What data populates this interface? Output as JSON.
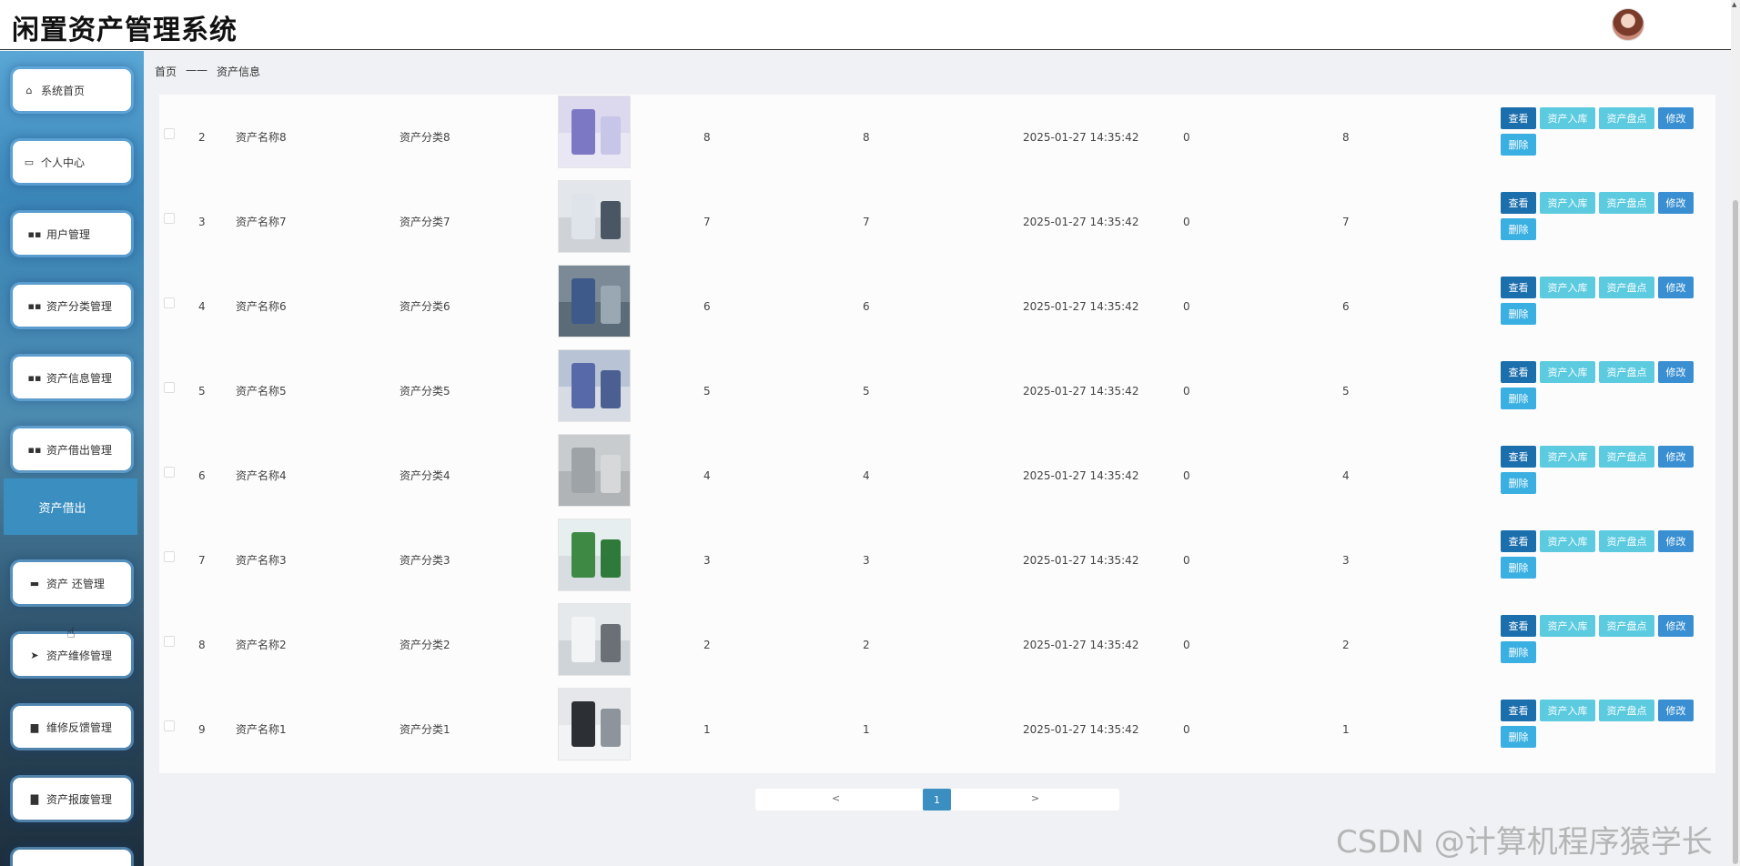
{
  "app": {
    "title": "闲置资产管理系统"
  },
  "sidebar": {
    "items": [
      {
        "label": "系统首页",
        "icon": "home-icon"
      },
      {
        "label": "个人中心",
        "icon": "card-icon"
      },
      {
        "label": "用户管理",
        "icon": "grid-icon"
      },
      {
        "label": "资产分类管理",
        "icon": "grid-icon"
      },
      {
        "label": "资产信息管理",
        "icon": "grid-icon"
      },
      {
        "label": "资产借出管理",
        "icon": "grid-icon"
      },
      {
        "label": "资产 还管理",
        "icon": "chat-icon"
      },
      {
        "label": "资产维修管理",
        "icon": "send-icon"
      },
      {
        "label": "维修反馈管理",
        "icon": "printer-icon"
      },
      {
        "label": "资产报废管理",
        "icon": "monitor-icon"
      }
    ],
    "submenu_active": "资产借出"
  },
  "breadcrumb": {
    "home": "首页",
    "separator": "——",
    "current": "资产信息"
  },
  "table": {
    "rows": [
      {
        "index": "2",
        "name": "资产名称8",
        "category": "资产分类8",
        "col_a": "8",
        "col_b": "8",
        "time": "2025-01-27 14:35:42",
        "col_c": "0",
        "col_d": "8"
      },
      {
        "index": "3",
        "name": "资产名称7",
        "category": "资产分类7",
        "col_a": "7",
        "col_b": "7",
        "time": "2025-01-27 14:35:42",
        "col_c": "0",
        "col_d": "7"
      },
      {
        "index": "4",
        "name": "资产名称6",
        "category": "资产分类6",
        "col_a": "6",
        "col_b": "6",
        "time": "2025-01-27 14:35:42",
        "col_c": "0",
        "col_d": "6"
      },
      {
        "index": "5",
        "name": "资产名称5",
        "category": "资产分类5",
        "col_a": "5",
        "col_b": "5",
        "time": "2025-01-27 14:35:42",
        "col_c": "0",
        "col_d": "5"
      },
      {
        "index": "6",
        "name": "资产名称4",
        "category": "资产分类4",
        "col_a": "4",
        "col_b": "4",
        "time": "2025-01-27 14:35:42",
        "col_c": "0",
        "col_d": "4"
      },
      {
        "index": "7",
        "name": "资产名称3",
        "category": "资产分类3",
        "col_a": "3",
        "col_b": "3",
        "time": "2025-01-27 14:35:42",
        "col_c": "0",
        "col_d": "3"
      },
      {
        "index": "8",
        "name": "资产名称2",
        "category": "资产分类2",
        "col_a": "2",
        "col_b": "2",
        "time": "2025-01-27 14:35:42",
        "col_c": "0",
        "col_d": "2"
      },
      {
        "index": "9",
        "name": "资产名称1",
        "category": "资产分类1",
        "col_a": "1",
        "col_b": "1",
        "time": "2025-01-27 14:35:42",
        "col_c": "0",
        "col_d": "1"
      }
    ],
    "actions": {
      "view": "查看",
      "stock_in": "资产入库",
      "inventory": "资产盘点",
      "edit": "修改",
      "delete": "删除"
    }
  },
  "pagination": {
    "prev": "<",
    "current": "1",
    "next": ">"
  },
  "watermark": "CSDN @计算机程序猿学长",
  "colors": {
    "primary": "#1c6fad",
    "accent": "#5ccbe0",
    "sidebar": "#3b8fc0"
  }
}
